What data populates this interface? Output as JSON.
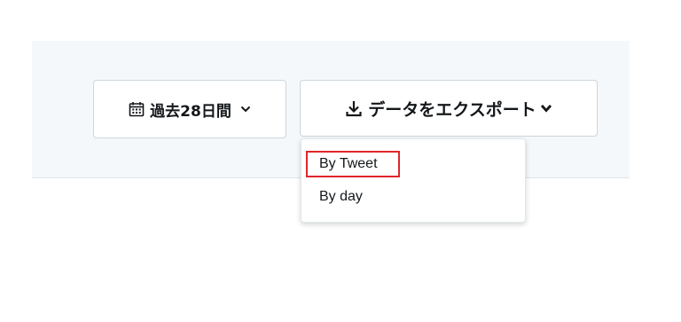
{
  "toolbar": {
    "date_range": {
      "label": "過去28日間",
      "icon": "calendar-icon",
      "chevron": "chevron-down-icon"
    },
    "export": {
      "label": "データをエクスポート",
      "icon": "download-icon",
      "chevron": "chevron-down-icon"
    }
  },
  "export_menu": {
    "items": [
      {
        "label": "By Tweet",
        "highlighted": true
      },
      {
        "label": "By day",
        "highlighted": false
      }
    ]
  },
  "colors": {
    "band_background": "#f5f8fa",
    "button_border": "#ccd6dd",
    "text": "#14171a",
    "highlight_border": "#e0262b"
  }
}
